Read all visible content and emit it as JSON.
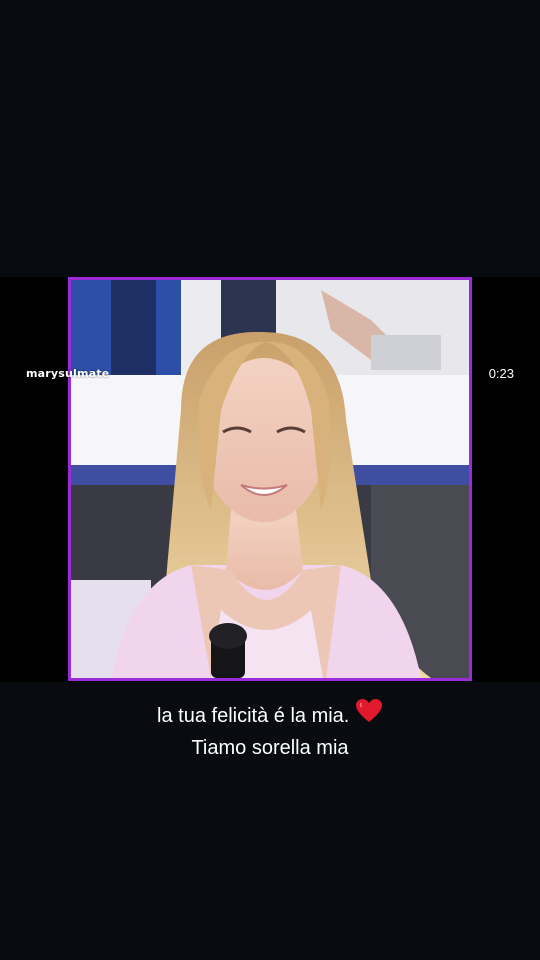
{
  "video": {
    "watermark": "marysulmate",
    "timestamp": "0:23",
    "frame_border_color": "#9b2bd6"
  },
  "caption": {
    "line1": "la tua felicità é la mia.",
    "emoji": "red-heart-icon",
    "line2": "Tiamo sorella mia"
  }
}
